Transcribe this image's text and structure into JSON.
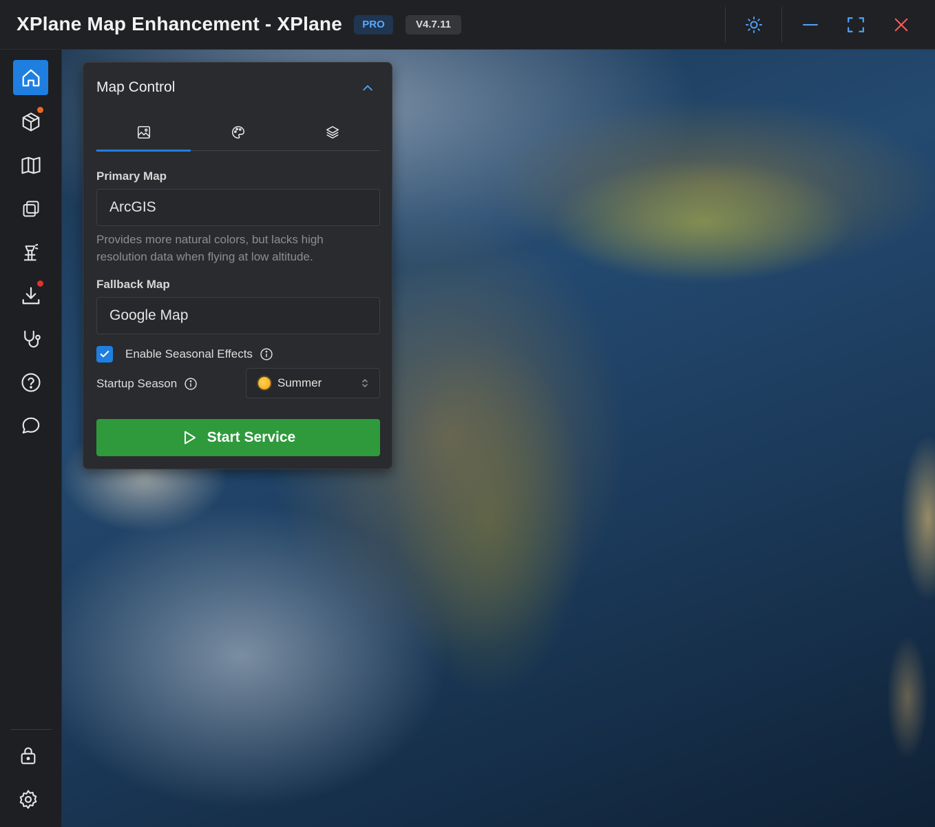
{
  "window": {
    "title": "XPlane Map Enhancement - XPlane",
    "badge_pro": "PRO",
    "version": "V4.7.11"
  },
  "sidebar": {
    "items": [
      {
        "icon": "home-icon",
        "active": true
      },
      {
        "icon": "package-icon",
        "notification": true,
        "dot_color": "#f0661f"
      },
      {
        "icon": "map-icon"
      },
      {
        "icon": "layers-copy-icon"
      },
      {
        "icon": "airport-tower-icon"
      },
      {
        "icon": "download-icon",
        "notification": true,
        "dot_color": "#e5322d"
      },
      {
        "icon": "stethoscope-icon"
      },
      {
        "icon": "help-icon"
      },
      {
        "icon": "chat-icon"
      },
      {
        "icon": "lock-icon"
      },
      {
        "icon": "settings-icon"
      }
    ]
  },
  "panel": {
    "title": "Map Control",
    "tabs": [
      {
        "icon": "image-icon",
        "active": true
      },
      {
        "icon": "palette-icon"
      },
      {
        "icon": "layers-icon"
      }
    ],
    "primary_map": {
      "label": "Primary Map",
      "value": "ArcGIS",
      "hint": "Provides more natural colors, but lacks high resolution data when flying at low altitude."
    },
    "fallback_map": {
      "label": "Fallback Map",
      "value": "Google Map"
    },
    "seasonal": {
      "label": "Enable Seasonal Effects",
      "checked": true
    },
    "startup_season": {
      "label": "Startup Season",
      "value": "Summer"
    },
    "start_button": "Start Service"
  },
  "colors": {
    "accent": "#1f7fe0",
    "start_button": "#2e9a3c",
    "close": "#ff5b5b"
  }
}
